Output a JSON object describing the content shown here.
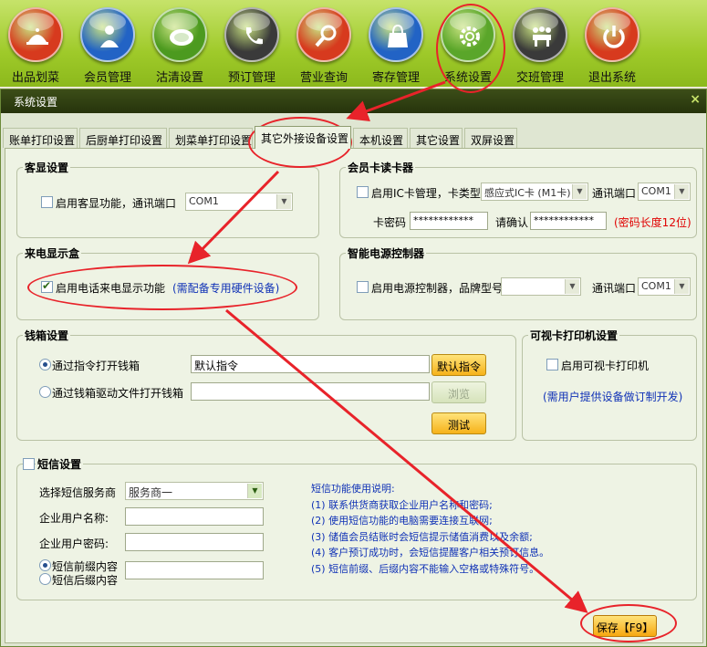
{
  "toolbar": {
    "items": [
      {
        "label": "出品划菜",
        "icon": "cloche-icon",
        "color": "#d73a1e"
      },
      {
        "label": "会员管理",
        "icon": "member-icon",
        "color": "#2263c5"
      },
      {
        "label": "沽清设置",
        "icon": "plate-icon",
        "color": "#4c9a1f"
      },
      {
        "label": "预订管理",
        "icon": "phone-icon",
        "color": "#3a3a3a"
      },
      {
        "label": "营业查询",
        "icon": "magnifier-icon",
        "color": "#d73a1e"
      },
      {
        "label": "寄存管理",
        "icon": "bag-icon",
        "color": "#2263c5"
      },
      {
        "label": "系统设置",
        "icon": "gear-icon",
        "color": "#5aa62a"
      },
      {
        "label": "交班管理",
        "icon": "meeting-icon",
        "color": "#3a3a3a"
      },
      {
        "label": "退出系统",
        "icon": "power-icon",
        "color": "#d73a1e"
      }
    ]
  },
  "dialog": {
    "title": "系统设置",
    "close": "×",
    "tabs": [
      "账单打印设置",
      "后厨单打印设置",
      "划菜单打印设置",
      "其它外接设备设置",
      "本机设置",
      "其它设置",
      "双屏设置"
    ],
    "active_tab": "其它外接设备设置"
  },
  "customer_display": {
    "title": "客显设置",
    "enable_label": "启用客显功能，通讯端口",
    "enabled": false,
    "port": "COM1"
  },
  "member_card": {
    "title": "会员卡读卡器",
    "enable_label": "启用IC卡管理，卡类型",
    "enabled": false,
    "card_type": "感应式IC卡 (M1卡)",
    "port_label": "通讯端口",
    "port": "COM1",
    "password_label": "卡密码",
    "password": "************",
    "confirm_label": "请确认",
    "confirm": "************",
    "hint": "(密码长度12位)"
  },
  "caller_id": {
    "title": "来电显示盒",
    "enable_label": "启用电话来电显示功能",
    "enabled": true,
    "hint": "(需配备专用硬件设备)"
  },
  "power_controller": {
    "title": "智能电源控制器",
    "enable_label": "启用电源控制器，品牌型号",
    "enabled": false,
    "brand": "",
    "port_label": "通讯端口",
    "port": "COM1"
  },
  "cash_drawer": {
    "title": "钱箱设置",
    "option_command": "通过指令打开钱箱",
    "option_driver": "通过钱箱驱动文件打开钱箱",
    "selected": "command",
    "command_value": "默认指令",
    "driver_value": "",
    "default_btn": "默认指令",
    "browse_btn": "浏览",
    "test_btn": "测试"
  },
  "visual_card_printer": {
    "title": "可视卡打印机设置",
    "enable_label": "启用可视卡打印机",
    "enabled": false,
    "hint": "(需用户提供设备做订制开发)"
  },
  "sms": {
    "title": "短信设置",
    "enabled": false,
    "provider_label": "选择短信服务商",
    "provider": "服务商一",
    "user_label": "企业用户名称:",
    "user_value": "",
    "pass_label": "企业用户密码:",
    "pass_value": "",
    "prefix_label": "短信前缀内容",
    "suffix_label": "短信后缀内容",
    "affix_selected": "prefix",
    "affix_value": "",
    "help_title": "短信功能使用说明:",
    "help": [
      "(1) 联系供货商获取企业用户名称和密码;",
      "(2) 使用短信功能的电脑需要连接互联网;",
      "(3) 储值会员结账时会短信提示储值消费以及余额;",
      "(4) 客户预订成功时，会短信提醒客户相关预订信息。",
      "(5) 短信前缀、后缀内容不能输入空格或特殊符号。"
    ]
  },
  "footer": {
    "save": "保存【F9】"
  },
  "colors": {
    "toolbar_green": "#9fca2a",
    "dialog_bg": "#eef3e4",
    "annotation_red": "#e8232a",
    "hint_blue": "#1032b6",
    "warn_red": "#e00000"
  }
}
